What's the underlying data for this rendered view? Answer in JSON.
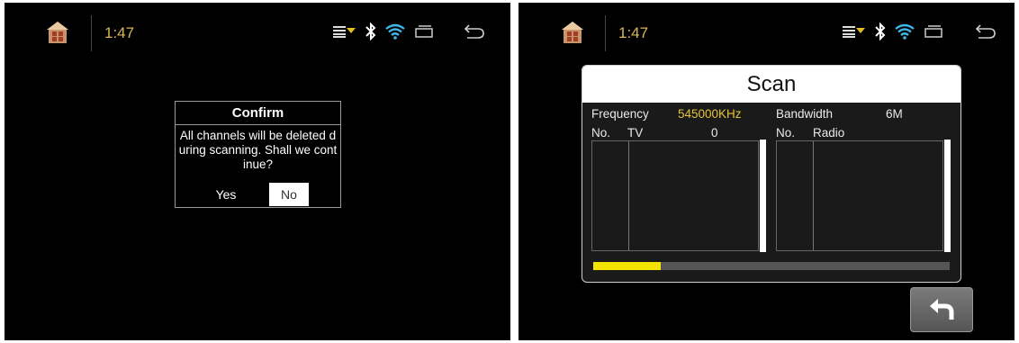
{
  "left_screen": {
    "status_bar": {
      "time": "1:47",
      "icons": [
        "home-icon",
        "menu-dropdown-icon",
        "bluetooth-icon",
        "wifi-icon",
        "recent-apps-icon",
        "back-arrow-icon"
      ]
    },
    "confirm_dialog": {
      "title": "Confirm",
      "message_line1": "All channels will be deleted d",
      "message_line2": "uring scanning. Shall we cont",
      "message_line3": "inue?",
      "yes_label": "Yes",
      "no_label": "No"
    }
  },
  "right_screen": {
    "status_bar": {
      "time": "1:47",
      "icons": [
        "home-icon",
        "menu-dropdown-icon",
        "bluetooth-icon",
        "wifi-icon",
        "recent-apps-icon",
        "back-arrow-icon"
      ]
    },
    "scan_dialog": {
      "title": "Scan",
      "frequency_label": "Frequency",
      "frequency_value": "545000KHz",
      "bandwidth_label": "Bandwidth",
      "bandwidth_value": "6M",
      "tv_list": {
        "no_header": "No.",
        "type_header": "TV",
        "count": "0"
      },
      "radio_list": {
        "no_header": "No.",
        "type_header": "Radio"
      },
      "progress_percent": 19
    },
    "return_button_icon": "return-arrow-icon"
  },
  "colors": {
    "clock": "#d8b75a",
    "frequency_value": "#e6c23a",
    "progress": "#f4e200",
    "wifi": "#3fb7e9"
  }
}
